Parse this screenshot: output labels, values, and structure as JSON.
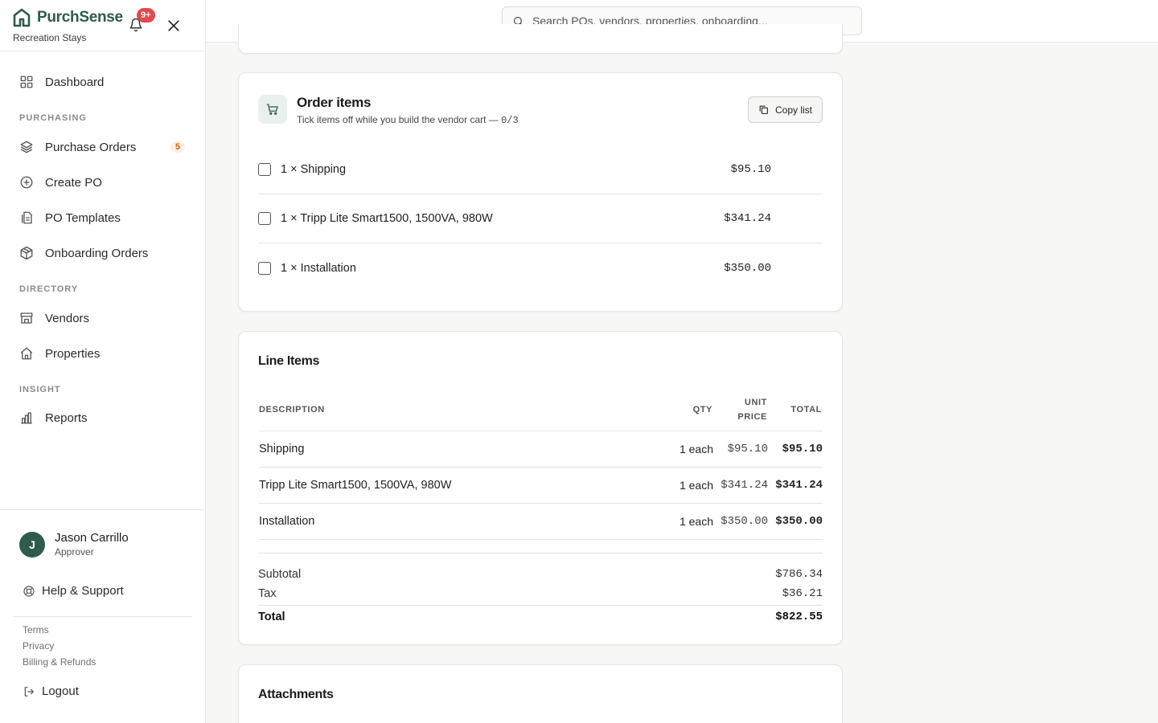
{
  "brand": {
    "name": "PurchSense",
    "org": "Recreation Stays",
    "notifications": "9+"
  },
  "search": {
    "placeholder": "Search POs, vendors, properties, onboarding..."
  },
  "nav": {
    "dashboard": "Dashboard",
    "purchasing_label": "PURCHASING",
    "purchase_orders": "Purchase Orders",
    "purchase_orders_count": "5",
    "create_po": "Create PO",
    "po_templates": "PO Templates",
    "onboarding_orders": "Onboarding Orders",
    "directory_label": "DIRECTORY",
    "vendors": "Vendors",
    "properties": "Properties",
    "insight_label": "INSIGHT",
    "reports": "Reports"
  },
  "user": {
    "initial": "J",
    "name": "Jason Carrillo",
    "role": "Approver"
  },
  "footer": {
    "help": "Help & Support",
    "terms": "Terms",
    "privacy": "Privacy",
    "billing": "Billing & Refunds",
    "logout": "Logout"
  },
  "order_items": {
    "title": "Order items",
    "subtitle": "Tick items off while you build the vendor cart — ",
    "progress": "0/3",
    "copy_label": "Copy list",
    "items": [
      {
        "label": "1 × Shipping",
        "price": "$95.10"
      },
      {
        "label": "1 × Tripp Lite Smart1500, 1500VA, 980W",
        "price": "$341.24"
      },
      {
        "label": "1 × Installation",
        "price": "$350.00"
      }
    ]
  },
  "line_items": {
    "title": "Line Items",
    "headers": {
      "description": "DESCRIPTION",
      "qty": "QTY",
      "unit_price_1": "UNIT",
      "unit_price_2": "PRICE",
      "total": "TOTAL"
    },
    "rows": [
      {
        "description": "Shipping",
        "qty": "1 each",
        "unit_price": "$95.10",
        "total": "$95.10"
      },
      {
        "description": "Tripp Lite Smart1500, 1500VA, 980W",
        "qty": "1 each",
        "unit_price": "$341.24",
        "total": "$341.24"
      },
      {
        "description": "Installation",
        "qty": "1 each",
        "unit_price": "$350.00",
        "total": "$350.00"
      }
    ],
    "subtotal_label": "Subtotal",
    "subtotal": "$786.34",
    "tax_label": "Tax",
    "tax": "$36.21",
    "total_label": "Total",
    "total": "$822.55"
  },
  "attachments": {
    "title": "Attachments"
  }
}
